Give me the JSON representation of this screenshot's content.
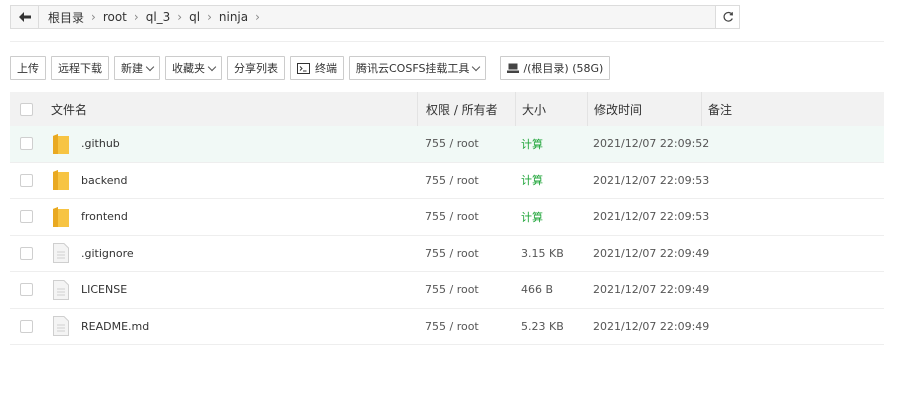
{
  "address": {
    "crumbs": [
      "根目录",
      "root",
      "ql_3",
      "ql",
      "ninja"
    ],
    "separator": "›"
  },
  "toolbar": {
    "upload": "上传",
    "remote_download": "远程下载",
    "new": "新建",
    "favorites": "收藏夹",
    "share_list": "分享列表",
    "terminal": "终端",
    "cosfs": "腾讯云COSFS挂载工具",
    "disk": "/(根目录) (58G)"
  },
  "table": {
    "headers": {
      "name": "文件名",
      "perm": "权限 / 所有者",
      "size": "大小",
      "time": "修改时间",
      "note": "备注"
    },
    "rows": [
      {
        "name": ".github",
        "type": "folder",
        "perm": "755 / root",
        "size": "计算",
        "time": "2021/12/07 22:09:52"
      },
      {
        "name": "backend",
        "type": "folder",
        "perm": "755 / root",
        "size": "计算",
        "time": "2021/12/07 22:09:53"
      },
      {
        "name": "frontend",
        "type": "folder",
        "perm": "755 / root",
        "size": "计算",
        "time": "2021/12/07 22:09:53"
      },
      {
        "name": ".gitignore",
        "type": "file",
        "perm": "755 / root",
        "size": "3.15 KB",
        "time": "2021/12/07 22:09:49"
      },
      {
        "name": "LICENSE",
        "type": "file",
        "perm": "755 / root",
        "size": "466 B",
        "time": "2021/12/07 22:09:49"
      },
      {
        "name": "README.md",
        "type": "file",
        "perm": "755 / root",
        "size": "5.23 KB",
        "time": "2021/12/07 22:09:49"
      }
    ]
  },
  "colors": {
    "folder": "#f7c443",
    "calc_link": "#20a53a",
    "row_highlight": "#f1f9f6"
  },
  "icons": {
    "back": "arrow-left-icon",
    "refresh": "refresh-icon",
    "terminal": "terminal-icon",
    "disk": "disk-icon",
    "folder": "folder-icon",
    "file": "file-icon"
  }
}
